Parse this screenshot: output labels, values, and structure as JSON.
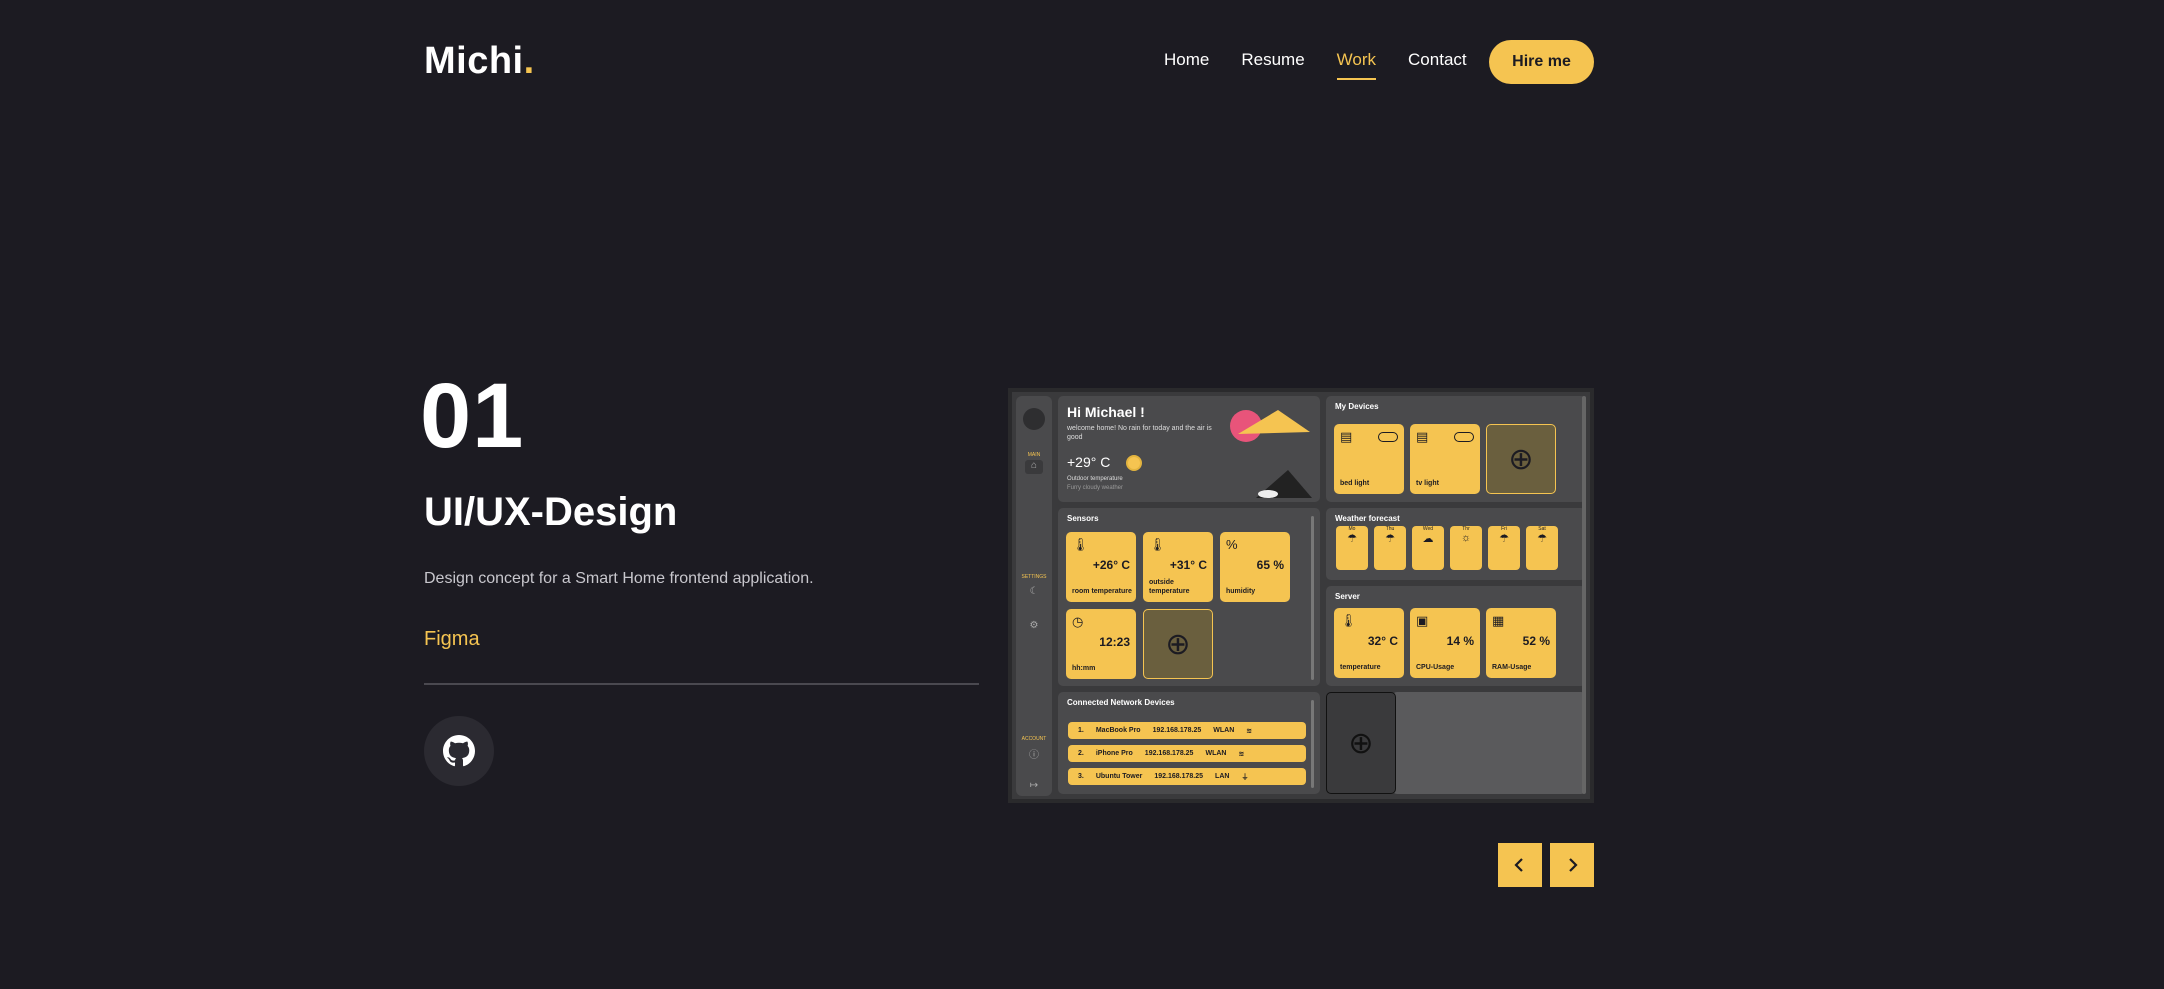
{
  "header": {
    "logo_text": "Michi",
    "logo_dot": ".",
    "nav": [
      {
        "label": "Home",
        "active": false
      },
      {
        "label": "Resume",
        "active": false
      },
      {
        "label": "Work",
        "active": true
      },
      {
        "label": "Contact",
        "active": false
      }
    ],
    "hire_label": "Hire me"
  },
  "project": {
    "number": "01",
    "title": "UI/UX-Design",
    "description": "Design concept for a Smart Home frontend application.",
    "tool": "Figma",
    "github_icon": "github-icon"
  },
  "preview": {
    "greeting": "Hi Michael !",
    "greeting_sub": "welcome home! No rain for today and the air is good",
    "outdoor_temp": "+29° C",
    "outdoor_label": "Outdoor temperature",
    "weather_desc": "Furry cloudy weather",
    "my_devices_title": "My Devices",
    "devices": [
      {
        "label": "bed light"
      },
      {
        "label": "tv light"
      }
    ],
    "sensors_title": "Sensors",
    "sensors": [
      {
        "value": "+26° C",
        "label": "room temperature"
      },
      {
        "value": "+31° C",
        "label": "outside temperature"
      },
      {
        "value": "65 %",
        "label": "humidity"
      },
      {
        "value": "12:23",
        "label": "hh:mm"
      }
    ],
    "weather_title": "Weather forecast",
    "weather_days": [
      "Mo",
      "Thu",
      "Wed",
      "Thr",
      "Fri",
      "Sat"
    ],
    "server_title": "Server",
    "server": [
      {
        "value": "32° C",
        "label": "temperature"
      },
      {
        "value": "14 %",
        "label": "CPU-Usage"
      },
      {
        "value": "52 %",
        "label": "RAM-Usage"
      }
    ],
    "network_title": "Connected Network Devices",
    "network": [
      {
        "idx": "1.",
        "name": "MacBook Pro",
        "ip": "192.168.178.25",
        "type": "WLAN"
      },
      {
        "idx": "2.",
        "name": "iPhone Pro",
        "ip": "192.168.178.25",
        "type": "WLAN"
      },
      {
        "idx": "3.",
        "name": "Ubuntu Tower",
        "ip": "192.168.178.25",
        "type": "LAN"
      }
    ],
    "side_labels": {
      "main": "MAIN",
      "settings": "SETTINGS",
      "account": "ACCOUNT"
    }
  },
  "colors": {
    "background": "#1c1b22",
    "accent": "#f5c451"
  }
}
